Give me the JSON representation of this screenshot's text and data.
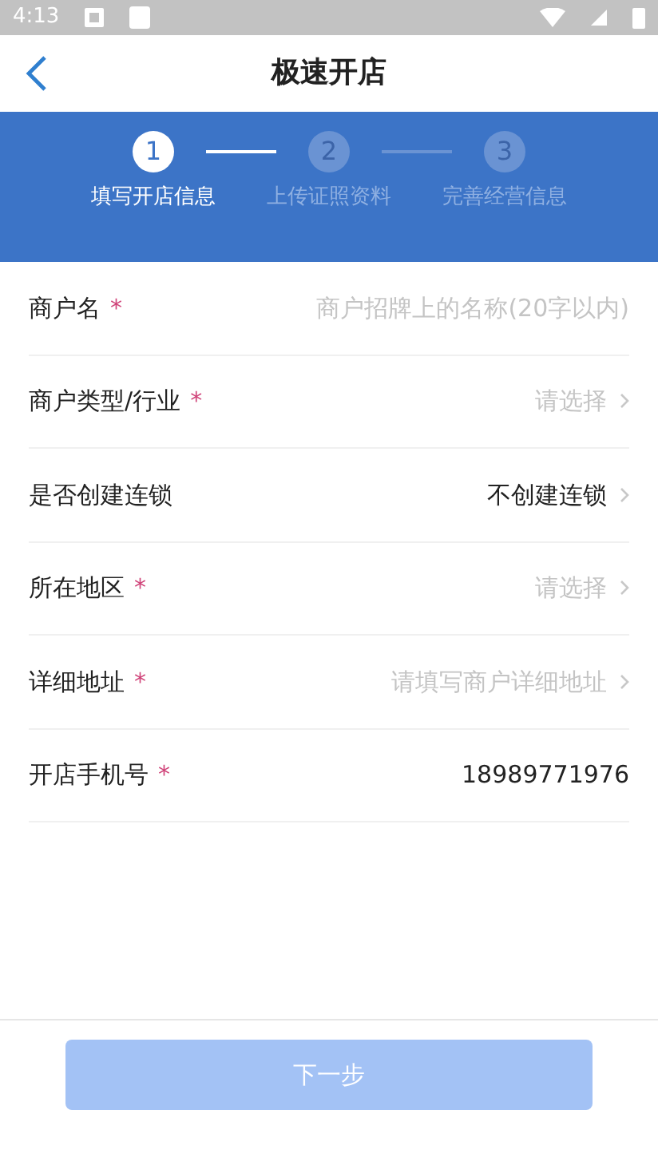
{
  "status_bar": {
    "time": "4:13"
  },
  "header": {
    "title": "极速开店"
  },
  "steps": [
    {
      "number": "1",
      "label": "填写开店信息",
      "selected": true
    },
    {
      "number": "2",
      "label": "上传证照资料",
      "selected": false
    },
    {
      "number": "3",
      "label": "完善经营信息",
      "selected": false
    }
  ],
  "fields": [
    {
      "kind": "input",
      "label": "商户名",
      "required_mark": "*",
      "placeholder": "商户招牌上的名称(20字以内)"
    },
    {
      "kind": "select",
      "label": "商户类型/行业",
      "required_mark": "*",
      "placeholder": "请选择"
    },
    {
      "kind": "select",
      "label": "是否创建连锁",
      "value": "不创建连锁"
    },
    {
      "kind": "select",
      "label": "所在地区",
      "required_mark": "*",
      "placeholder": "请选择"
    },
    {
      "kind": "select",
      "label": "详细地址",
      "required_mark": "*",
      "placeholder": "请填写商户详细地址"
    },
    {
      "kind": "input",
      "label": "开店手机号",
      "required_mark": "*",
      "value": "18989771976"
    }
  ],
  "next_button": {
    "label": "下一步",
    "disabled": true
  }
}
